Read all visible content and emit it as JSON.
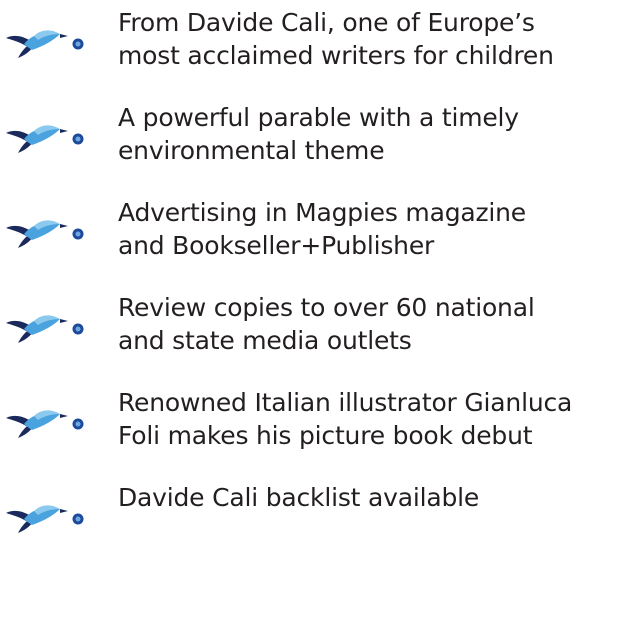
{
  "items": [
    {
      "text": "From Davide Cali, one of Europe’s\nmost acclaimed writers for children",
      "icon": "bird-bullet-icon"
    },
    {
      "text": "A powerful parable with a timely\nenvironmental theme",
      "icon": "bird-bullet-icon"
    },
    {
      "text": "Advertising in Magpies magazine\nand Bookseller+Publisher",
      "icon": "bird-bullet-icon"
    },
    {
      "text": "Review copies to over 60 national\nand state media outlets",
      "icon": "bird-bullet-icon"
    },
    {
      "text": "Renowned Italian illustrator Gianluca\nFoli makes his picture book debut",
      "icon": "bird-bullet-icon"
    },
    {
      "text": "Davide Cali backlist available",
      "icon": "bird-bullet-icon"
    }
  ],
  "colors": {
    "text": "#231f20",
    "bird_blue": "#4aa3df",
    "bird_dark": "#1a2a5c",
    "dot_blue": "#1b4b9a"
  }
}
